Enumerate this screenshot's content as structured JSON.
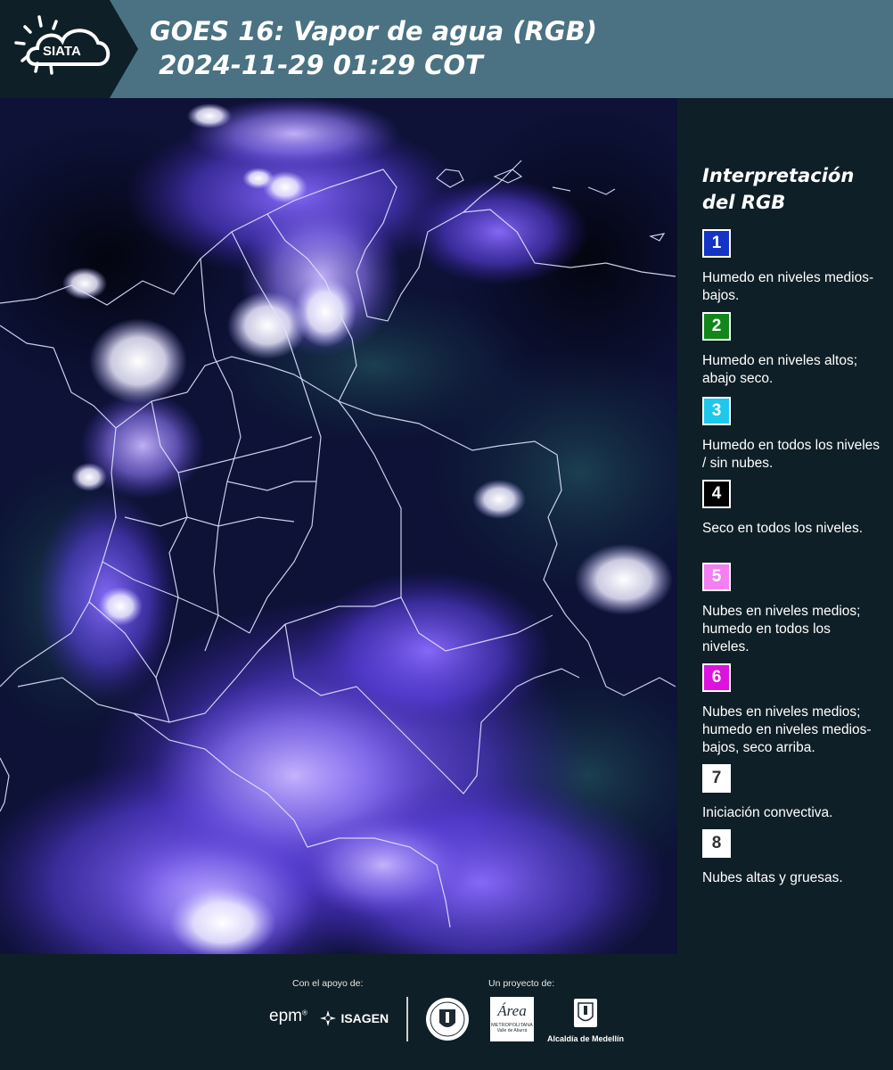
{
  "header": {
    "logo_text": "SIATA",
    "title_line1": "GOES 16: Vapor de agua (RGB)",
    "title_line2": " 2024-11-29 01:29 COT",
    "background_color": "#4a7282"
  },
  "legend": {
    "title": "Interpretación del RGB",
    "items": [
      {
        "number": "1",
        "color": "#1334c4",
        "text": "Humedo en niveles medios-bajos."
      },
      {
        "number": "2",
        "color": "#12861a",
        "text": "Humedo en niveles altos; abajo seco."
      },
      {
        "number": "3",
        "color": "#1ec8ec",
        "text": "Humedo en todos los niveles / sin nubes."
      },
      {
        "number": "4",
        "color": "#000000",
        "text": "Seco en todos los niveles."
      },
      {
        "number": "5",
        "color": "#f37ff0",
        "text": "Nubes en niveles medios; humedo en todos los niveles."
      },
      {
        "number": "6",
        "color": "#dc12de",
        "text": "Nubes en niveles medios; humedo en niveles medios-bajos, seco arriba."
      },
      {
        "number": "7",
        "color": "#ffffff",
        "text": "Iniciación convectiva."
      },
      {
        "number": "8",
        "color": "#ffffff",
        "text": "Nubes altas y gruesas."
      }
    ]
  },
  "footer": {
    "support_label": "Con el apoyo de:",
    "project_label": "Un proyecto de:",
    "sponsors": [
      "epm",
      "ISAGEN"
    ],
    "partners": [
      "Área Metropolitana Valle de Aburrá",
      "Alcaldía de Medellín"
    ],
    "epm_reg": "®",
    "area_name": "Área",
    "area_sub1": "METROPOLITANA",
    "area_sub2": "Valle de Aburrá"
  }
}
